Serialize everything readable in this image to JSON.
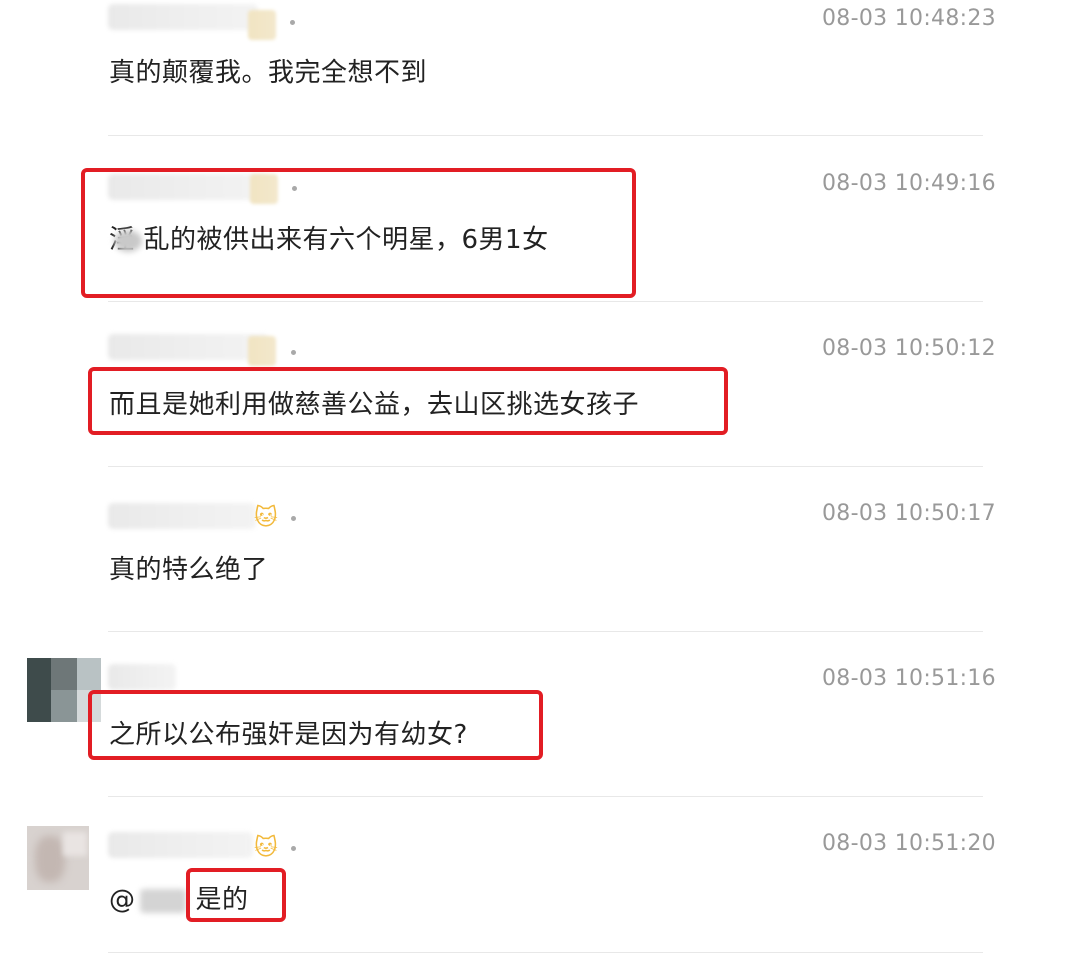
{
  "comments": [
    {
      "timestamp": "08-03 10:48:23",
      "text": "真的颠覆我。我完全想不到"
    },
    {
      "timestamp": "08-03 10:49:16",
      "text": "乱的被供出来有六个明星，6男1女",
      "text_prefix": "淫"
    },
    {
      "timestamp": "08-03 10:50:12",
      "text": "而且是她利用做慈善公益，去山区挑选女孩子"
    },
    {
      "timestamp": "08-03 10:50:17",
      "text": "真的特么绝了"
    },
    {
      "timestamp": "08-03 10:51:16",
      "text": "之所以公布强奸是因为有幼女?"
    },
    {
      "timestamp": "08-03 10:51:20",
      "mention": "@",
      "text": "是的"
    }
  ],
  "colors": {
    "highlight": "#e21d24",
    "timestamp": "#999999",
    "text": "#222222",
    "divider": "#e8e8e8"
  },
  "icons": [
    "cat-face-emoji-icon",
    "cat-face-emoji-icon"
  ]
}
